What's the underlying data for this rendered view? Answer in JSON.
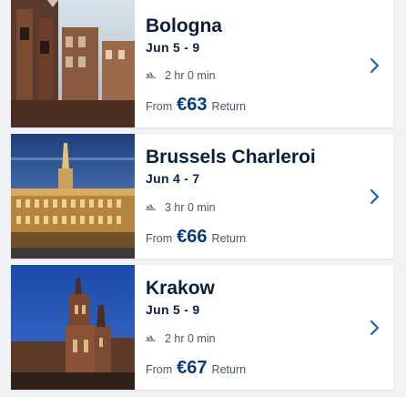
{
  "destinations": [
    {
      "city": "Bologna",
      "dates": "Jun 5 - 9",
      "duration": "2 hr 0 min",
      "price_prefix": "From",
      "price": "€63",
      "price_suffix": "Return",
      "image": "bologna-towers-photo"
    },
    {
      "city": "Brussels Charleroi",
      "dates": "Jun 4 - 7",
      "duration": "3 hr 0 min",
      "price_prefix": "From",
      "price": "€66",
      "price_suffix": "Return",
      "image": "brussels-grand-place-photo"
    },
    {
      "city": "Krakow",
      "dates": "Jun 5 - 9",
      "duration": "2 hr 0 min",
      "price_prefix": "From",
      "price": "€67",
      "price_suffix": "Return",
      "image": "krakow-basilica-photo"
    }
  ],
  "icons": {
    "flight": "plane-icon",
    "open": "chevron-right-icon"
  },
  "colors": {
    "price": "#0a3a7e",
    "chevron": "#1f5fbf",
    "text": "#0b1f3a",
    "muted": "#4a5566"
  }
}
